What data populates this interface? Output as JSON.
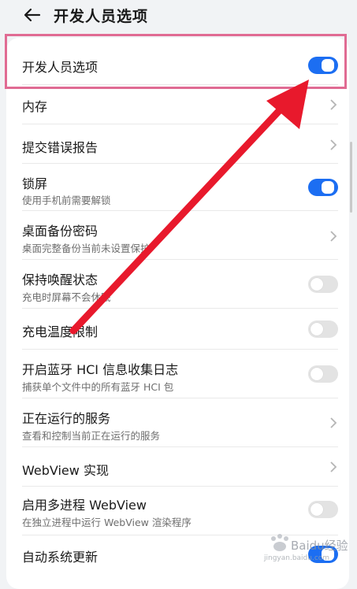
{
  "header": {
    "title": "开发人员选项"
  },
  "rows": [
    {
      "title": "开发人员选项",
      "control": "toggle",
      "state": "on"
    },
    {
      "title": "内存",
      "control": "chevron"
    },
    {
      "title": "提交错误报告",
      "control": "chevron"
    },
    {
      "title": "锁屏",
      "subtitle": "使用手机前需要解锁",
      "control": "toggle",
      "state": "on"
    },
    {
      "title": "桌面备份密码",
      "subtitle": "桌面完整备份当前未设置保护",
      "control": "chevron"
    },
    {
      "title": "保持唤醒状态",
      "subtitle": "充电时屏幕不会休眠",
      "control": "toggle",
      "state": "off"
    },
    {
      "title": "充电温度限制",
      "control": "toggle",
      "state": "off"
    },
    {
      "title": "开启蓝牙 HCI 信息收集日志",
      "subtitle": "捕获单个文件中的所有蓝牙 HCI 包",
      "control": "toggle",
      "state": "off"
    },
    {
      "title": "正在运行的服务",
      "subtitle": "查看和控制当前正在运行的服务",
      "control": "chevron"
    },
    {
      "title": "WebView 实现",
      "control": "chevron"
    },
    {
      "title": "启用多进程 WebView",
      "subtitle": "在独立进程中运行 WebView 渲染程序",
      "control": "toggle",
      "state": "off"
    },
    {
      "title": "自动系统更新",
      "control": "toggle",
      "state": "on"
    }
  ],
  "watermark": {
    "brand": "Baidu经验",
    "url": "jingyan.baidu.com"
  },
  "colors": {
    "accent": "#1c6ef2",
    "highlight": "#e06b93",
    "arrow": "#e8192c"
  }
}
